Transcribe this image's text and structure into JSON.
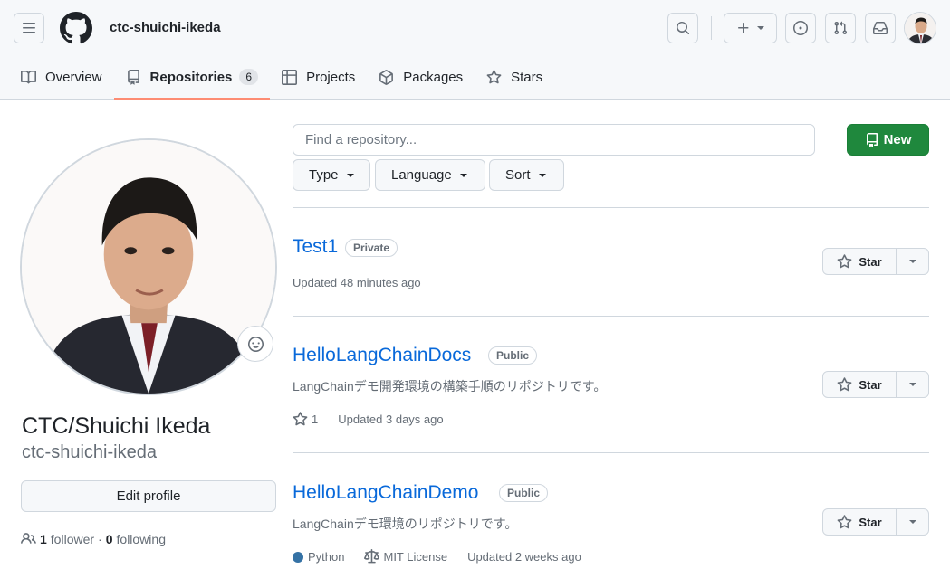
{
  "header": {
    "username": "ctc-shuichi-ikeda"
  },
  "tabs": [
    {
      "label": "Overview"
    },
    {
      "label": "Repositories",
      "count": "6"
    },
    {
      "label": "Projects"
    },
    {
      "label": "Packages"
    },
    {
      "label": "Stars"
    }
  ],
  "profile": {
    "fullname": "CTC/Shuichi Ikeda",
    "login": "ctc-shuichi-ikeda",
    "edit_label": "Edit profile",
    "followers_count": "1",
    "followers_label": "follower",
    "separator": "·",
    "following_count": "0",
    "following_label": "following"
  },
  "toolbar": {
    "search_placeholder": "Find a repository...",
    "new_label": "New",
    "type_label": "Type",
    "language_label": "Language",
    "sort_label": "Sort"
  },
  "repos": [
    {
      "name": "Test1",
      "visibility": "Private",
      "description": "",
      "updated": "Updated 48 minutes ago",
      "star_label": "Star"
    },
    {
      "name": "HelloLangChainDocs",
      "visibility": "Public",
      "description": "LangChainデモ開発環境の構築手順のリポジトリです。",
      "stars": "1",
      "updated": "Updated 3 days ago",
      "star_label": "Star"
    },
    {
      "name": "HelloLangChainDemo",
      "visibility": "Public",
      "description": "LangChainデモ環境のリポジトリです。",
      "language": "Python",
      "language_color": "#3572A5",
      "license": "MIT License",
      "updated": "Updated 2 weeks ago",
      "star_label": "Star"
    }
  ],
  "colors": {
    "accent": "#0969da",
    "new_button": "#1f883d",
    "tab_underline": "#fd8c73"
  }
}
